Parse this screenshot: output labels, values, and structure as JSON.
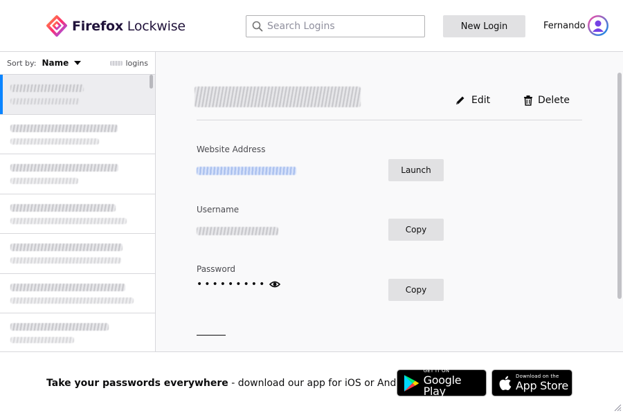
{
  "header": {
    "brand_name_bold": "Firefox",
    "brand_name_light": " Lockwise",
    "search_placeholder": "Search Logins",
    "new_login_label": "New Login",
    "user_name": "Fernando"
  },
  "sidebar": {
    "sort_label": "Sort by:",
    "sort_value": "Name",
    "count_label": "logins",
    "items": [
      {
        "selected": true
      },
      {
        "selected": false
      },
      {
        "selected": false
      },
      {
        "selected": false
      },
      {
        "selected": false
      },
      {
        "selected": false
      },
      {
        "selected": false
      }
    ]
  },
  "detail": {
    "edit_label": "Edit",
    "delete_label": "Delete",
    "website_label": "Website Address",
    "launch_label": "Launch",
    "username_label": "Username",
    "copy_username_label": "Copy",
    "password_label": "Password",
    "password_masked": "•••••••••",
    "copy_password_label": "Copy"
  },
  "footer": {
    "promo_bold": "Take your passwords everywhere",
    "promo_rest": " - download our app for iOS or Android:",
    "google_small": "GET IT ON",
    "google_big": "Google Play",
    "apple_small": "Download on the",
    "apple_big": "App Store"
  },
  "colors": {
    "accent": "#0a84ff",
    "brand_text": "#20123a",
    "button_bg": "#e1e1e3"
  }
}
